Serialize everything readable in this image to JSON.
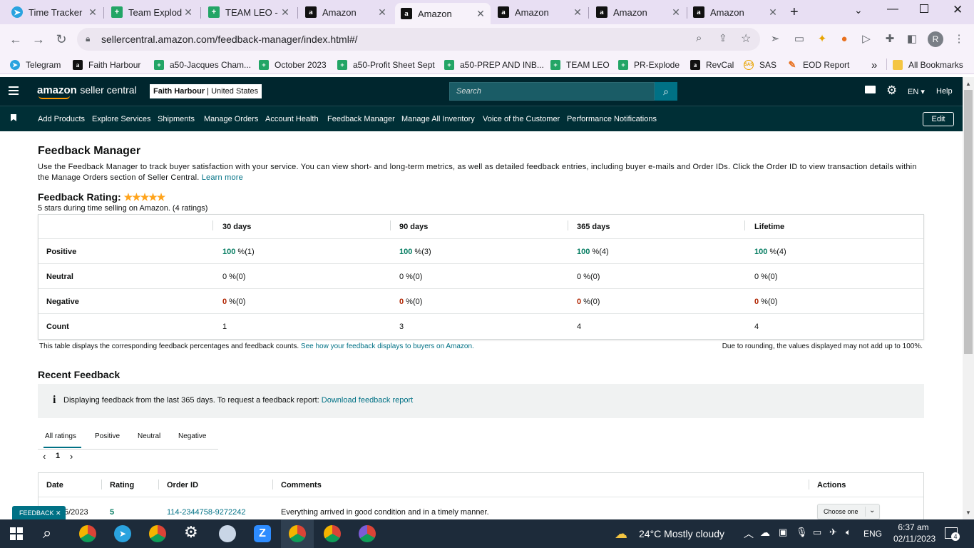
{
  "browser": {
    "tabs": [
      {
        "title": "Time Tracker",
        "icon": "telegram-icon"
      },
      {
        "title": "Team Explod",
        "icon": "sheets-icon"
      },
      {
        "title": "TEAM LEO -",
        "icon": "sheets-icon"
      },
      {
        "title": "Amazon",
        "icon": "amazon-icon"
      },
      {
        "title": "Amazon",
        "icon": "amazon-icon",
        "active": true
      },
      {
        "title": "Amazon",
        "icon": "amazon-icon"
      },
      {
        "title": "Amazon",
        "icon": "amazon-icon"
      },
      {
        "title": "Amazon",
        "icon": "amazon-icon"
      }
    ],
    "url": "sellercentral.amazon.com/feedback-manager/index.html#/",
    "profile_initial": "R",
    "bookmarks": [
      {
        "label": "Telegram",
        "icon": "telegram-icon"
      },
      {
        "label": "Faith Harbour",
        "icon": "amazon-icon"
      },
      {
        "label": "a50-Jacques Cham...",
        "icon": "sheets-icon"
      },
      {
        "label": "October 2023",
        "icon": "sheets-icon"
      },
      {
        "label": "a50-Profit Sheet Sept",
        "icon": "sheets-icon"
      },
      {
        "label": "a50-PREP AND INB...",
        "icon": "sheets-icon"
      },
      {
        "label": "TEAM LEO",
        "icon": "sheets-icon"
      },
      {
        "label": "PR-Explode",
        "icon": "sheets-icon"
      },
      {
        "label": "RevCal",
        "icon": "amazon-icon"
      },
      {
        "label": "SAS",
        "icon": "sas-icon"
      },
      {
        "label": "EOD Report",
        "icon": "eod-icon"
      }
    ],
    "all_bookmarks": "All Bookmarks",
    "bookmark_overflow": "»"
  },
  "seller": {
    "logo_main": "amazon",
    "logo_sub": "seller central",
    "store_name": "Faith Harbour",
    "marketplace": "United States",
    "search_placeholder": "Search",
    "language": "EN",
    "help": "Help",
    "nav": [
      "Add Products",
      "Explore Services",
      "Shipments",
      "Manage Orders",
      "Account Health",
      "Feedback Manager",
      "Manage All Inventory",
      "Voice of the Customer",
      "Performance Notifications"
    ],
    "edit": "Edit"
  },
  "page": {
    "title": "Feedback Manager",
    "description": "Use the Feedback Manager to track buyer satisfaction with your service. You can view short- and long-term metrics, as well as detailed feedback entries, including buyer e-mails and Order IDs. Click the Order ID to view transaction details within the Manage Orders section of Seller Central.",
    "learn_more": "Learn more",
    "rating_label": "Feedback Rating:",
    "stars": 5,
    "rating_summary": "5 stars during time selling on Amazon. (4 ratings)",
    "table": {
      "columns": [
        "30 days",
        "90 days",
        "365 days",
        "Lifetime"
      ],
      "rows": [
        {
          "label": "Positive",
          "values": [
            [
              "100",
              " %(1)"
            ],
            [
              "100",
              " %(3)"
            ],
            [
              "100",
              " %(4)"
            ],
            [
              "100",
              " %(4)"
            ]
          ],
          "style": "green"
        },
        {
          "label": "Neutral",
          "values": [
            [
              "0",
              " %(0)"
            ],
            [
              "0",
              " %(0)"
            ],
            [
              "0",
              " %(0)"
            ],
            [
              "0",
              " %(0)"
            ]
          ],
          "style": "plain"
        },
        {
          "label": "Negative",
          "values": [
            [
              "0",
              " %(0)"
            ],
            [
              "0",
              " %(0)"
            ],
            [
              "0",
              " %(0)"
            ],
            [
              "0",
              " %(0)"
            ]
          ],
          "style": "red"
        },
        {
          "label": "Count",
          "values": [
            [
              "1",
              ""
            ],
            [
              "3",
              ""
            ],
            [
              "4",
              ""
            ],
            [
              "4",
              ""
            ]
          ],
          "style": "plain"
        }
      ],
      "footnote": "This table displays the corresponding feedback percentages and feedback counts.",
      "footnote_link": "See how your feedback displays to buyers on Amazon.",
      "rounding_note": "Due to rounding, the values displayed may not add up to 100%."
    },
    "recent_title": "Recent Feedback",
    "info_text": "Displaying feedback from the last 365 days. To request a feedback report:",
    "info_link": "Download feedback report",
    "tabs": [
      "All ratings",
      "Positive",
      "Neutral",
      "Negative"
    ],
    "pager": {
      "prev": "‹",
      "page": "1",
      "next": "›"
    },
    "feed_columns": [
      "Date",
      "Rating",
      "Order ID",
      "Comments",
      "Actions"
    ],
    "feed_rows": [
      {
        "date": "5/2023",
        "rating": "5",
        "order_id": "114-2344758-9272242",
        "comment": "Everything arrived in good condition and in a timely manner.",
        "action": "Choose one"
      }
    ],
    "feedback_tab": "FEEDBACK"
  },
  "taskbar": {
    "weather": "24°C  Mostly cloudy",
    "language": "ENG",
    "time": "6:37 am",
    "date": "02/11/2023",
    "notifications": "4"
  },
  "colors": {
    "header_bg": "#00262e",
    "nav_bg": "#002f36",
    "search_btn": "#007185",
    "positive": "#067d62",
    "negative": "#b12704",
    "star": "#ffa41c"
  }
}
